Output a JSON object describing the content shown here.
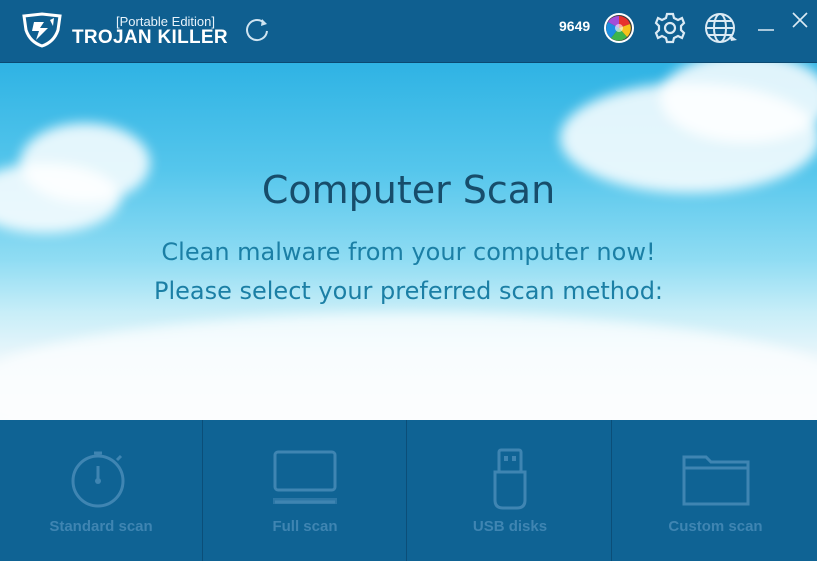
{
  "titlebar": {
    "edition": "[Portable Edition]",
    "brand": "TROJAN KILLER",
    "count": "9649",
    "icons": [
      "shield-logo-icon",
      "refresh-icon",
      "license-ball-icon",
      "gear-icon",
      "globe-icon",
      "minimize-icon",
      "close-icon"
    ]
  },
  "hero": {
    "title": "Computer Scan",
    "line1": "Clean malware from your computer now!",
    "line2": "Please select your preferred scan method:"
  },
  "scans": [
    {
      "label": "Standard scan",
      "icon": "stopwatch-icon"
    },
    {
      "label": "Full scan",
      "icon": "laptop-icon"
    },
    {
      "label": "USB disks",
      "icon": "usb-drive-icon"
    },
    {
      "label": "Custom scan",
      "icon": "folder-icon"
    }
  ],
  "colors": {
    "titlebar": "#0f5f90",
    "scanbar": "#0f6394",
    "label_dim": "#3f85b2",
    "title_text": "#174d6b",
    "subtitle_text": "#1b7fa5"
  }
}
